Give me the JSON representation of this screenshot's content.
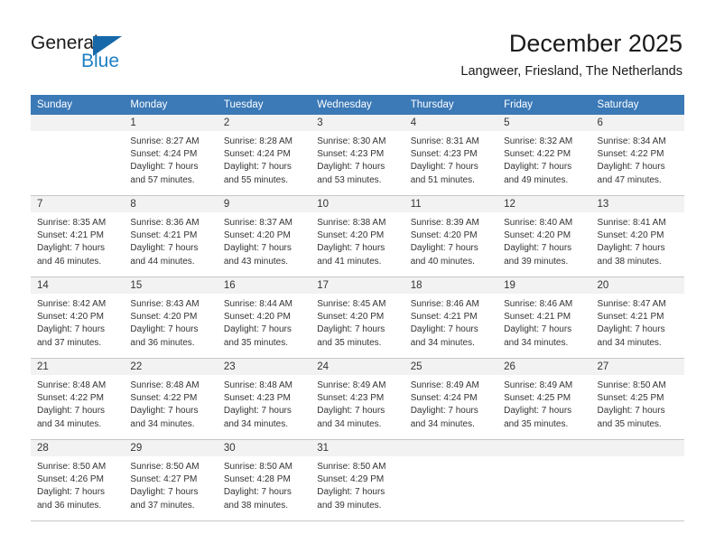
{
  "brand": {
    "name_part1": "General",
    "name_part2": "Blue",
    "flag_icon": "blue-triangle-flag-icon"
  },
  "header": {
    "title": "December 2025",
    "subtitle": "Langweer, Friesland, The Netherlands"
  },
  "colors": {
    "header_blue": "#3b79b7",
    "brand_blue": "#1f7fc4",
    "daynum_bar": "#f2f2f2",
    "cell_border": "#c8c8c8",
    "text": "#333333"
  },
  "weekdays": [
    "Sunday",
    "Monday",
    "Tuesday",
    "Wednesday",
    "Thursday",
    "Friday",
    "Saturday"
  ],
  "weeks": [
    [
      {
        "day": "",
        "sunrise": "",
        "sunset": "",
        "daylight1": "",
        "daylight2": ""
      },
      {
        "day": "1",
        "sunrise": "Sunrise: 8:27 AM",
        "sunset": "Sunset: 4:24 PM",
        "daylight1": "Daylight: 7 hours",
        "daylight2": "and 57 minutes."
      },
      {
        "day": "2",
        "sunrise": "Sunrise: 8:28 AM",
        "sunset": "Sunset: 4:24 PM",
        "daylight1": "Daylight: 7 hours",
        "daylight2": "and 55 minutes."
      },
      {
        "day": "3",
        "sunrise": "Sunrise: 8:30 AM",
        "sunset": "Sunset: 4:23 PM",
        "daylight1": "Daylight: 7 hours",
        "daylight2": "and 53 minutes."
      },
      {
        "day": "4",
        "sunrise": "Sunrise: 8:31 AM",
        "sunset": "Sunset: 4:23 PM",
        "daylight1": "Daylight: 7 hours",
        "daylight2": "and 51 minutes."
      },
      {
        "day": "5",
        "sunrise": "Sunrise: 8:32 AM",
        "sunset": "Sunset: 4:22 PM",
        "daylight1": "Daylight: 7 hours",
        "daylight2": "and 49 minutes."
      },
      {
        "day": "6",
        "sunrise": "Sunrise: 8:34 AM",
        "sunset": "Sunset: 4:22 PM",
        "daylight1": "Daylight: 7 hours",
        "daylight2": "and 47 minutes."
      }
    ],
    [
      {
        "day": "7",
        "sunrise": "Sunrise: 8:35 AM",
        "sunset": "Sunset: 4:21 PM",
        "daylight1": "Daylight: 7 hours",
        "daylight2": "and 46 minutes."
      },
      {
        "day": "8",
        "sunrise": "Sunrise: 8:36 AM",
        "sunset": "Sunset: 4:21 PM",
        "daylight1": "Daylight: 7 hours",
        "daylight2": "and 44 minutes."
      },
      {
        "day": "9",
        "sunrise": "Sunrise: 8:37 AM",
        "sunset": "Sunset: 4:20 PM",
        "daylight1": "Daylight: 7 hours",
        "daylight2": "and 43 minutes."
      },
      {
        "day": "10",
        "sunrise": "Sunrise: 8:38 AM",
        "sunset": "Sunset: 4:20 PM",
        "daylight1": "Daylight: 7 hours",
        "daylight2": "and 41 minutes."
      },
      {
        "day": "11",
        "sunrise": "Sunrise: 8:39 AM",
        "sunset": "Sunset: 4:20 PM",
        "daylight1": "Daylight: 7 hours",
        "daylight2": "and 40 minutes."
      },
      {
        "day": "12",
        "sunrise": "Sunrise: 8:40 AM",
        "sunset": "Sunset: 4:20 PM",
        "daylight1": "Daylight: 7 hours",
        "daylight2": "and 39 minutes."
      },
      {
        "day": "13",
        "sunrise": "Sunrise: 8:41 AM",
        "sunset": "Sunset: 4:20 PM",
        "daylight1": "Daylight: 7 hours",
        "daylight2": "and 38 minutes."
      }
    ],
    [
      {
        "day": "14",
        "sunrise": "Sunrise: 8:42 AM",
        "sunset": "Sunset: 4:20 PM",
        "daylight1": "Daylight: 7 hours",
        "daylight2": "and 37 minutes."
      },
      {
        "day": "15",
        "sunrise": "Sunrise: 8:43 AM",
        "sunset": "Sunset: 4:20 PM",
        "daylight1": "Daylight: 7 hours",
        "daylight2": "and 36 minutes."
      },
      {
        "day": "16",
        "sunrise": "Sunrise: 8:44 AM",
        "sunset": "Sunset: 4:20 PM",
        "daylight1": "Daylight: 7 hours",
        "daylight2": "and 35 minutes."
      },
      {
        "day": "17",
        "sunrise": "Sunrise: 8:45 AM",
        "sunset": "Sunset: 4:20 PM",
        "daylight1": "Daylight: 7 hours",
        "daylight2": "and 35 minutes."
      },
      {
        "day": "18",
        "sunrise": "Sunrise: 8:46 AM",
        "sunset": "Sunset: 4:21 PM",
        "daylight1": "Daylight: 7 hours",
        "daylight2": "and 34 minutes."
      },
      {
        "day": "19",
        "sunrise": "Sunrise: 8:46 AM",
        "sunset": "Sunset: 4:21 PM",
        "daylight1": "Daylight: 7 hours",
        "daylight2": "and 34 minutes."
      },
      {
        "day": "20",
        "sunrise": "Sunrise: 8:47 AM",
        "sunset": "Sunset: 4:21 PM",
        "daylight1": "Daylight: 7 hours",
        "daylight2": "and 34 minutes."
      }
    ],
    [
      {
        "day": "21",
        "sunrise": "Sunrise: 8:48 AM",
        "sunset": "Sunset: 4:22 PM",
        "daylight1": "Daylight: 7 hours",
        "daylight2": "and 34 minutes."
      },
      {
        "day": "22",
        "sunrise": "Sunrise: 8:48 AM",
        "sunset": "Sunset: 4:22 PM",
        "daylight1": "Daylight: 7 hours",
        "daylight2": "and 34 minutes."
      },
      {
        "day": "23",
        "sunrise": "Sunrise: 8:48 AM",
        "sunset": "Sunset: 4:23 PM",
        "daylight1": "Daylight: 7 hours",
        "daylight2": "and 34 minutes."
      },
      {
        "day": "24",
        "sunrise": "Sunrise: 8:49 AM",
        "sunset": "Sunset: 4:23 PM",
        "daylight1": "Daylight: 7 hours",
        "daylight2": "and 34 minutes."
      },
      {
        "day": "25",
        "sunrise": "Sunrise: 8:49 AM",
        "sunset": "Sunset: 4:24 PM",
        "daylight1": "Daylight: 7 hours",
        "daylight2": "and 34 minutes."
      },
      {
        "day": "26",
        "sunrise": "Sunrise: 8:49 AM",
        "sunset": "Sunset: 4:25 PM",
        "daylight1": "Daylight: 7 hours",
        "daylight2": "and 35 minutes."
      },
      {
        "day": "27",
        "sunrise": "Sunrise: 8:50 AM",
        "sunset": "Sunset: 4:25 PM",
        "daylight1": "Daylight: 7 hours",
        "daylight2": "and 35 minutes."
      }
    ],
    [
      {
        "day": "28",
        "sunrise": "Sunrise: 8:50 AM",
        "sunset": "Sunset: 4:26 PM",
        "daylight1": "Daylight: 7 hours",
        "daylight2": "and 36 minutes."
      },
      {
        "day": "29",
        "sunrise": "Sunrise: 8:50 AM",
        "sunset": "Sunset: 4:27 PM",
        "daylight1": "Daylight: 7 hours",
        "daylight2": "and 37 minutes."
      },
      {
        "day": "30",
        "sunrise": "Sunrise: 8:50 AM",
        "sunset": "Sunset: 4:28 PM",
        "daylight1": "Daylight: 7 hours",
        "daylight2": "and 38 minutes."
      },
      {
        "day": "31",
        "sunrise": "Sunrise: 8:50 AM",
        "sunset": "Sunset: 4:29 PM",
        "daylight1": "Daylight: 7 hours",
        "daylight2": "and 39 minutes."
      },
      {
        "day": "",
        "sunrise": "",
        "sunset": "",
        "daylight1": "",
        "daylight2": ""
      },
      {
        "day": "",
        "sunrise": "",
        "sunset": "",
        "daylight1": "",
        "daylight2": ""
      },
      {
        "day": "",
        "sunrise": "",
        "sunset": "",
        "daylight1": "",
        "daylight2": ""
      }
    ]
  ]
}
